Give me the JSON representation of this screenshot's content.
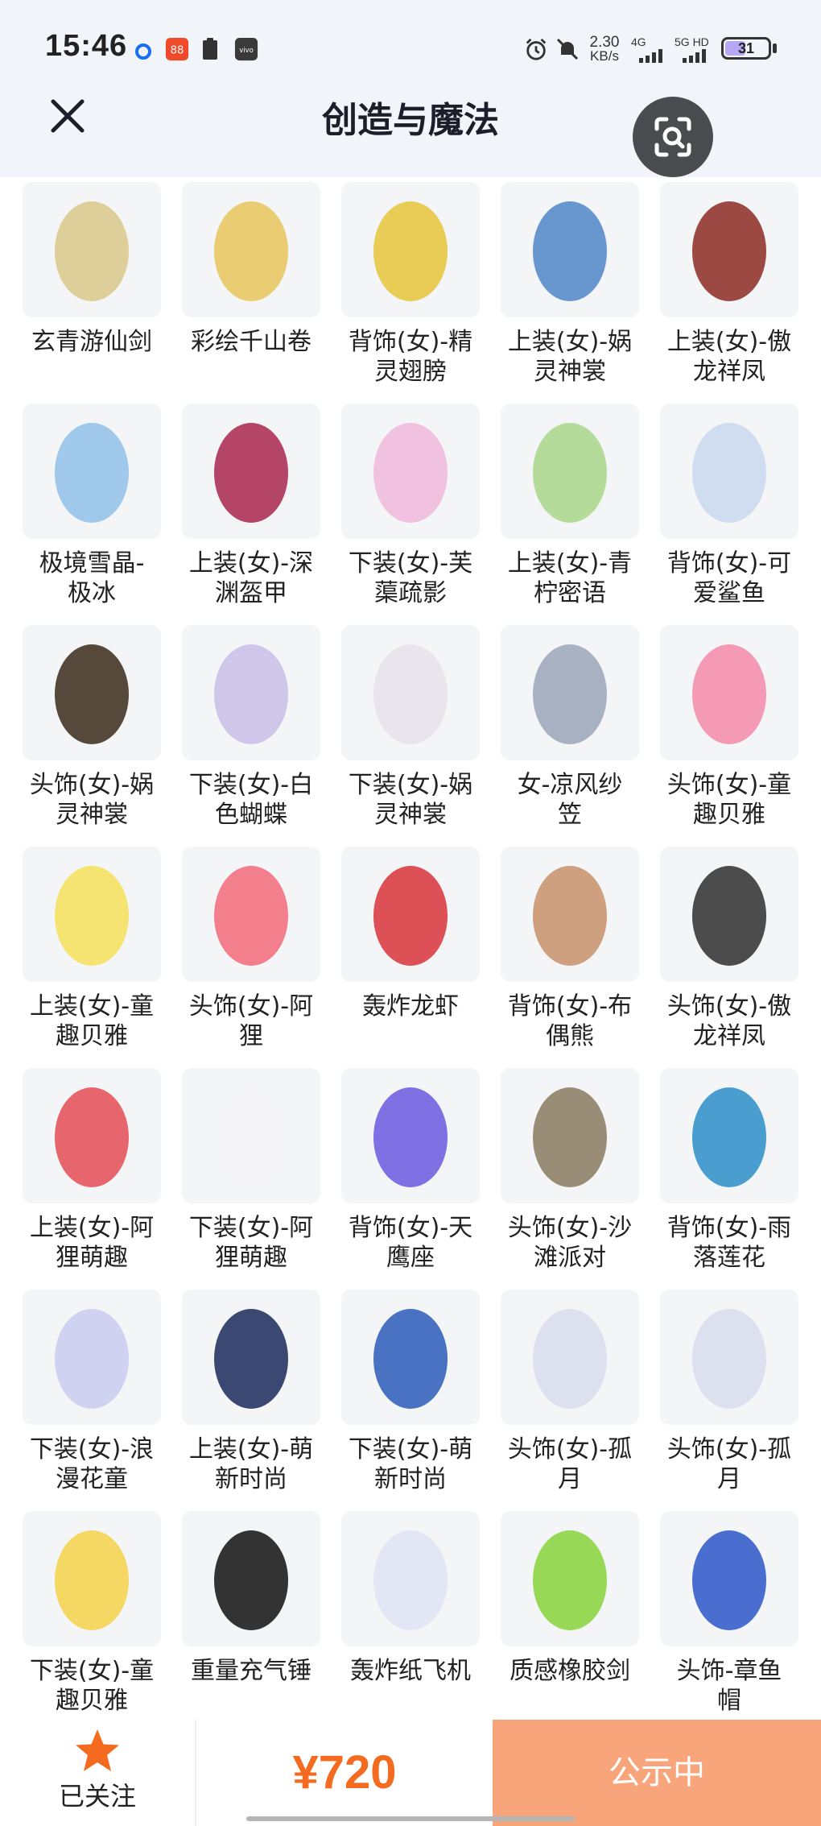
{
  "status": {
    "time": "15:46",
    "speed_value": "2.30",
    "speed_unit": "KB/s",
    "net1": "4G",
    "net2": "5G HD",
    "battery": "31"
  },
  "header": {
    "title": "创造与魔法"
  },
  "items": [
    "玄青游仙剑",
    "彩绘千山卷",
    "背饰(女)-精灵翅膀",
    "上装(女)-娲灵神裳",
    "上装(女)-傲龙祥凤",
    "极境雪晶-极冰",
    "上装(女)-深渊盔甲",
    "下装(女)-芙蕖疏影",
    "上装(女)-青柠密语",
    "背饰(女)-可爱鲨鱼",
    "头饰(女)-娲灵神裳",
    "下装(女)-白色蝴蝶",
    "下装(女)-娲灵神裳",
    "女-凉风纱笠",
    "头饰(女)-童趣贝雅",
    "上装(女)-童趣贝雅",
    "头饰(女)-阿狸",
    "轰炸龙虾",
    "背饰(女)-布偶熊",
    "头饰(女)-傲龙祥凤",
    "上装(女)-阿狸萌趣",
    "下装(女)-阿狸萌趣",
    "背饰(女)-天鹰座",
    "头饰(女)-沙滩派对",
    "背饰(女)-雨落莲花",
    "下装(女)-浪漫花童",
    "上装(女)-萌新时尚",
    "下装(女)-萌新时尚",
    "头饰(女)-孤月",
    "头饰(女)-孤月",
    "下装(女)-童趣贝雅",
    "重量充气锤",
    "轰炸纸飞机",
    "质感橡胶剑",
    "头饰-章鱼帽"
  ],
  "item_lines": [
    [
      "玄青游仙剑"
    ],
    [
      "彩绘千山卷"
    ],
    [
      "背饰(女)-精",
      "灵翅膀"
    ],
    [
      "上装(女)-娲",
      "灵神裳"
    ],
    [
      "上装(女)-傲",
      "龙祥凤"
    ],
    [
      "极境雪晶-",
      "极冰"
    ],
    [
      "上装(女)-深",
      "渊盔甲"
    ],
    [
      "下装(女)-芙",
      "蕖疏影"
    ],
    [
      "上装(女)-青",
      "柠密语"
    ],
    [
      "背饰(女)-可",
      "爱鲨鱼"
    ],
    [
      "头饰(女)-娲",
      "灵神裳"
    ],
    [
      "下装(女)-白",
      "色蝴蝶"
    ],
    [
      "下装(女)-娲",
      "灵神裳"
    ],
    [
      "女-凉风纱",
      "笠"
    ],
    [
      "头饰(女)-童",
      "趣贝雅"
    ],
    [
      "上装(女)-童",
      "趣贝雅"
    ],
    [
      "头饰(女)-阿",
      "狸"
    ],
    [
      "轰炸龙虾"
    ],
    [
      "背饰(女)-布",
      "偶熊"
    ],
    [
      "头饰(女)-傲",
      "龙祥凤"
    ],
    [
      "上装(女)-阿",
      "狸萌趣"
    ],
    [
      "下装(女)-阿",
      "狸萌趣"
    ],
    [
      "背饰(女)-天",
      "鹰座"
    ],
    [
      "头饰(女)-沙",
      "滩派对"
    ],
    [
      "背饰(女)-雨",
      "落莲花"
    ],
    [
      "下装(女)-浪",
      "漫花童"
    ],
    [
      "上装(女)-萌",
      "新时尚"
    ],
    [
      "下装(女)-萌",
      "新时尚"
    ],
    [
      "头饰(女)-孤",
      "月"
    ],
    [
      "头饰(女)-孤",
      "月"
    ],
    [
      "下装(女)-童",
      "趣贝雅"
    ],
    [
      "重量充气锤"
    ],
    [
      "轰炸纸飞机"
    ],
    [
      "质感橡胶剑"
    ],
    [
      "头饰-章鱼",
      "帽"
    ]
  ],
  "thumb_colors": [
    "#d9c88a",
    "#e8c65a",
    "#e6c43a",
    "#4f86c8",
    "#8c2a24",
    "#8fc0e8",
    "#a8264e",
    "#f0b8dc",
    "#a8d68a",
    "#c9d8ef",
    "#3a2a1a",
    "#c9bde8",
    "#e8e0ea",
    "#9aa6b8",
    "#f48aa8",
    "#f4e05a",
    "#f26a7a",
    "#d8343a",
    "#c8906a",
    "#2e2e2e",
    "#e44b55",
    "#f4f4f8",
    "#6a58e0",
    "#8a7a62",
    "#2a8ec8",
    "#c8cdf0",
    "#1a2a5a",
    "#2a5ab8",
    "#d8dcec",
    "#d8dcec",
    "#f4d24a",
    "#111111",
    "#dfe4f4",
    "#86d43a",
    "#2a56c8"
  ],
  "bottom": {
    "follow_label": "已关注",
    "price": "¥720",
    "cta_label": "公示中"
  },
  "colors": {
    "accent": "#f46a1e",
    "cta_bg": "#f9a57b",
    "star": "#f46a1e"
  }
}
